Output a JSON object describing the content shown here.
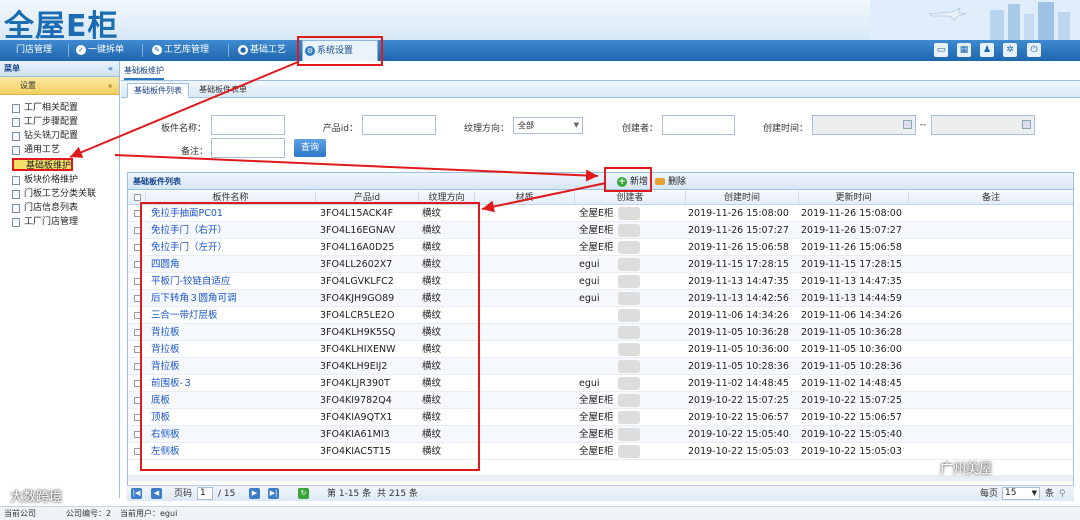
{
  "header": {
    "logo": "全屋E柜"
  },
  "nav": {
    "tabs": [
      {
        "label": "门店管理",
        "icon": "store-icon"
      },
      {
        "label": "一键拆单",
        "icon": "check-circle-icon"
      },
      {
        "label": "工艺库管理",
        "icon": "pen-icon"
      },
      {
        "label": "基础工艺",
        "icon": "circle-icon"
      },
      {
        "label": "系统设置",
        "icon": "settings-icon",
        "active": true
      }
    ],
    "right_icons": [
      "monitor-icon",
      "calendar-icon",
      "user-icon",
      "gear-icon",
      "power-icon"
    ]
  },
  "sidebar": {
    "title": "菜单",
    "collapse": "«",
    "section": "设置",
    "section_caret": "»",
    "items": [
      {
        "label": "工厂相关配置"
      },
      {
        "label": "工厂步骤配置"
      },
      {
        "label": "钻头铣刀配置"
      },
      {
        "label": "通用工艺"
      },
      {
        "label": "基础板维护",
        "selected": true
      },
      {
        "label": "板块价格维护"
      },
      {
        "label": "门板工艺分类关联"
      },
      {
        "label": "门店信息列表"
      },
      {
        "label": "工厂门店管理"
      }
    ]
  },
  "main_tab": "基础板维护",
  "subtabs": [
    {
      "label": "基础板件列表",
      "active": true
    },
    {
      "label": "基础板件表单",
      "active": false
    }
  ],
  "form": {
    "name_label": "板件名称：",
    "product_label": "产品id：",
    "grain_label": "纹理方向：",
    "grain_value": "全部",
    "creator_label": "创建者：",
    "ctime_label": "创建时间：",
    "range_sep": "--",
    "remark_label": "备注：",
    "query": "查询"
  },
  "grid": {
    "title": "基础板件列表",
    "add": "新增",
    "delete": "删除",
    "columns": [
      "板件名称",
      "产品id",
      "纹理方向",
      "材质",
      "创建者",
      "创建时间",
      "更新时间",
      "备注"
    ],
    "rows": [
      {
        "name": "免拉手抽面PC01",
        "pid": "3FO4L15ACK4F",
        "grain": "横纹",
        "creator": "全屋E柜",
        "ctime": "2019-11-26 15:08:00",
        "utime": "2019-11-26 15:08:00"
      },
      {
        "name": "免拉手门（右开）",
        "pid": "3FO4L16EGNAV",
        "grain": "横纹",
        "creator": "全屋E柜",
        "ctime": "2019-11-26 15:07:27",
        "utime": "2019-11-26 15:07:27"
      },
      {
        "name": "免拉手门（左开）",
        "pid": "3FO4L16A0D25",
        "grain": "横纹",
        "creator": "全屋E柜",
        "ctime": "2019-11-26 15:06:58",
        "utime": "2019-11-26 15:06:58"
      },
      {
        "name": "四圆角",
        "pid": "3FO4LL2602X7",
        "grain": "横纹",
        "creator": "egui",
        "ctime": "2019-11-15 17:28:15",
        "utime": "2019-11-15 17:28:15"
      },
      {
        "name": "平板门-铰链自适应",
        "pid": "3FO4LGVKLFC2",
        "grain": "横纹",
        "creator": "egui",
        "ctime": "2019-11-13 14:47:35",
        "utime": "2019-11-13 14:47:35"
      },
      {
        "name": "后下转角３圆角可调",
        "pid": "3FO4KJH9GO89",
        "grain": "横纹",
        "creator": "egui",
        "ctime": "2019-11-13 14:42:56",
        "utime": "2019-11-13 14:44:59"
      },
      {
        "name": "三合一带灯层板",
        "pid": "3FO4LCR5LE2O",
        "grain": "横纹",
        "creator": "",
        "ctime": "2019-11-06 14:34:26",
        "utime": "2019-11-06 14:34:26"
      },
      {
        "name": "背拉板",
        "pid": "3FO4KLH9K5SQ",
        "grain": "横纹",
        "creator": "",
        "ctime": "2019-11-05 10:36:28",
        "utime": "2019-11-05 10:36:28"
      },
      {
        "name": "背拉板",
        "pid": "3FO4KLHIXENW",
        "grain": "横纹",
        "creator": "",
        "ctime": "2019-11-05 10:36:00",
        "utime": "2019-11-05 10:36:00"
      },
      {
        "name": "背拉板",
        "pid": "3FO4KLH9EIJ2",
        "grain": "横纹",
        "creator": "",
        "ctime": "2019-11-05 10:28:36",
        "utime": "2019-11-05 10:28:36"
      },
      {
        "name": "前围板-３",
        "pid": "3FO4KLJR390T",
        "grain": "横纹",
        "creator": "egui",
        "ctime": "2019-11-02 14:48:45",
        "utime": "2019-11-02 14:48:45"
      },
      {
        "name": "底板",
        "pid": "3FO4KI9782Q4",
        "grain": "横纹",
        "creator": "全屋E柜",
        "ctime": "2019-10-22 15:07:25",
        "utime": "2019-10-22 15:07:25"
      },
      {
        "name": "顶板",
        "pid": "3FO4KIA9QTX1",
        "grain": "横纹",
        "creator": "全屋E柜",
        "ctime": "2019-10-22 15:06:57",
        "utime": "2019-10-22 15:06:57"
      },
      {
        "name": "右侧板",
        "pid": "3FO4KIA61MI3",
        "grain": "横纹",
        "creator": "全屋E柜",
        "ctime": "2019-10-22 15:05:40",
        "utime": "2019-10-22 15:05:40"
      },
      {
        "name": "左侧板",
        "pid": "3FO4KIAC5T15",
        "grain": "横纹",
        "creator": "全屋E柜",
        "ctime": "2019-10-22 15:05:03",
        "utime": "2019-10-22 15:05:03"
      }
    ]
  },
  "pager": {
    "page_label": "页码",
    "page": "1",
    "total_pages": "/ 15",
    "range": "第 1-15 条",
    "total": "共 215 条",
    "per_page_label": "每页",
    "per_page": "15",
    "unit": "条"
  },
  "status": {
    "left": "当前公司",
    "mid": "公司编号：2",
    "user": "当前用户：egui"
  },
  "watermarks": {
    "left": "大数跨境",
    "right": "广州美屋"
  },
  "colors": {
    "accent": "#1e66ad",
    "highlight": "#e01a1a",
    "link": "#1a55c7"
  }
}
